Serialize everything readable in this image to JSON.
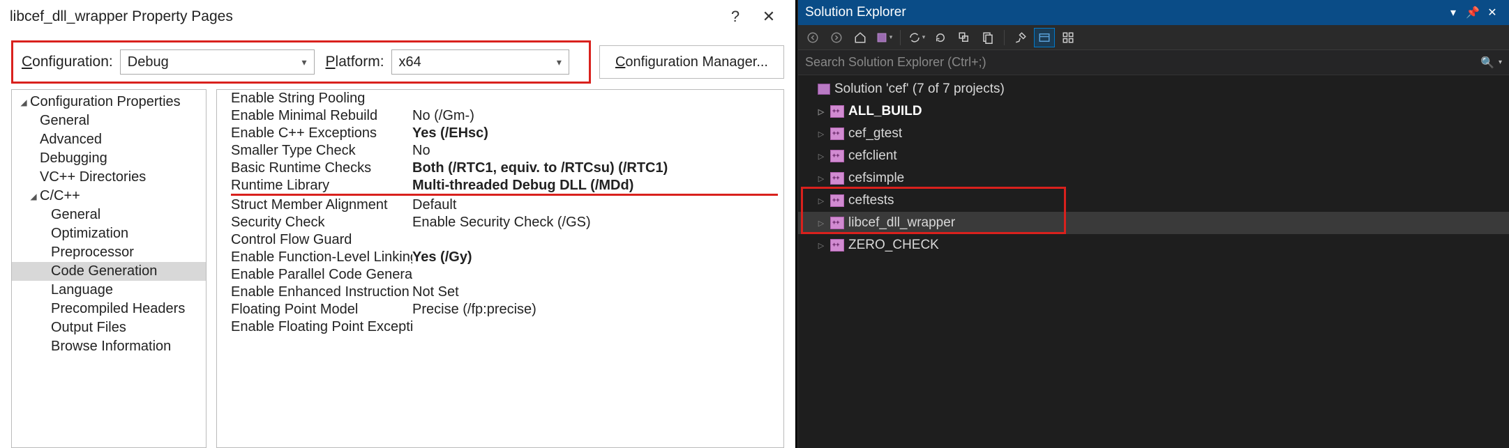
{
  "dialog": {
    "title": "libcef_dll_wrapper Property Pages",
    "help": "?",
    "close": "✕",
    "config_label_pre": "C",
    "config_label_post": "onfiguration:",
    "config_value": "Debug",
    "platform_label_pre": "P",
    "platform_label_post": "latform:",
    "platform_value": "x64",
    "configmgr_pre": "C",
    "configmgr_post": "onfiguration Manager..."
  },
  "tree": {
    "root": "Configuration Properties",
    "items": [
      "General",
      "Advanced",
      "Debugging",
      "VC++ Directories"
    ],
    "cpp": "C/C++",
    "cpp_children": [
      "General",
      "Optimization",
      "Preprocessor",
      "Code Generation",
      "Language",
      "Precompiled Headers",
      "Output Files",
      "Browse Information"
    ],
    "selected": "Code Generation"
  },
  "props": [
    {
      "name": "Enable String Pooling",
      "value": "",
      "bold": false
    },
    {
      "name": "Enable Minimal Rebuild",
      "value": "No (/Gm-)",
      "bold": false
    },
    {
      "name": "Enable C++ Exceptions",
      "value": "Yes (/EHsc)",
      "bold": true
    },
    {
      "name": "Smaller Type Check",
      "value": "No",
      "bold": false
    },
    {
      "name": "Basic Runtime Checks",
      "value": "Both (/RTC1, equiv. to /RTCsu) (/RTC1)",
      "bold": true
    },
    {
      "name": "Runtime Library",
      "value": "Multi-threaded Debug DLL (/MDd)",
      "bold": true,
      "redline": true
    },
    {
      "name": "Struct Member Alignment",
      "value": "Default",
      "bold": false
    },
    {
      "name": "Security Check",
      "value": "Enable Security Check (/GS)",
      "bold": false
    },
    {
      "name": "Control Flow Guard",
      "value": "",
      "bold": false
    },
    {
      "name": "Enable Function-Level Linking",
      "value": "Yes (/Gy)",
      "bold": true
    },
    {
      "name": "Enable Parallel Code Generation",
      "value": "",
      "bold": false
    },
    {
      "name": "Enable Enhanced Instruction Se",
      "value": "Not Set",
      "bold": false
    },
    {
      "name": "Floating Point Model",
      "value": "Precise (/fp:precise)",
      "bold": false
    },
    {
      "name": "Enable Floating Point Exception",
      "value": "",
      "bold": false
    }
  ],
  "solexp": {
    "title": "Solution Explorer",
    "search_placeholder": "Search Solution Explorer (Ctrl+;)",
    "solution": "Solution 'cef' (7 of 7 projects)",
    "projects": [
      {
        "name": "ALL_BUILD",
        "bold": true
      },
      {
        "name": "cef_gtest",
        "bold": false
      },
      {
        "name": "cefclient",
        "bold": false
      },
      {
        "name": "cefsimple",
        "bold": false
      },
      {
        "name": "ceftests",
        "bold": false
      },
      {
        "name": "libcef_dll_wrapper",
        "bold": false,
        "selected": true
      },
      {
        "name": "ZERO_CHECK",
        "bold": false
      }
    ]
  }
}
